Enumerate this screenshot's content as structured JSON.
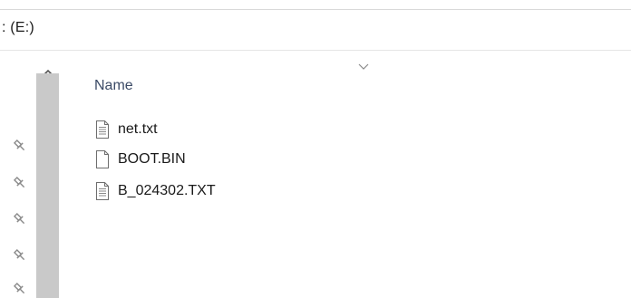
{
  "address": {
    "path": ": (E:)"
  },
  "file_list": {
    "column_name": "Name",
    "files": [
      {
        "name": "net.txt",
        "icon": "text-file-icon"
      },
      {
        "name": "BOOT.BIN",
        "icon": "blank-file-icon"
      },
      {
        "name": "B_024302.TXT",
        "icon": "text-file-icon"
      }
    ]
  },
  "navigation": {
    "pinned_count": 5,
    "scroll_up_icon": "chevron-up-icon",
    "pin_icon": "pin-icon"
  },
  "colors": {
    "header_text": "#3b4a66",
    "scrollbar": "#c9c9c9",
    "pin": "#8a8a8a"
  }
}
